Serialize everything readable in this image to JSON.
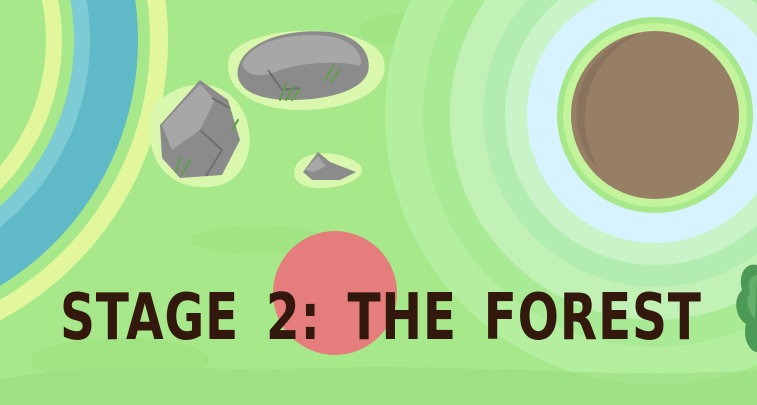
{
  "stage": {
    "title": "STAGE 2: THE FOREST"
  },
  "colors": {
    "grass": "#a6e88a",
    "grass_light": "#c3f39a",
    "grass_pale": "#daf8ad",
    "river_water": "#5fb9c7",
    "river_bank": "#e2f79c",
    "rock": "#a7a7a7",
    "rock_shadow": "#8b8b8b",
    "rock_dark": "#6f6f6f",
    "pit": "#977f66",
    "pit_ring": "#d7f3ff",
    "player_ball": "#e47d7b",
    "bush": "#4d9a57",
    "title_text": "#33180d"
  },
  "icons": {
    "player": "red-ball-icon",
    "rocks": "rock-icon",
    "pit": "pit-icon",
    "bush": "bush-icon"
  }
}
